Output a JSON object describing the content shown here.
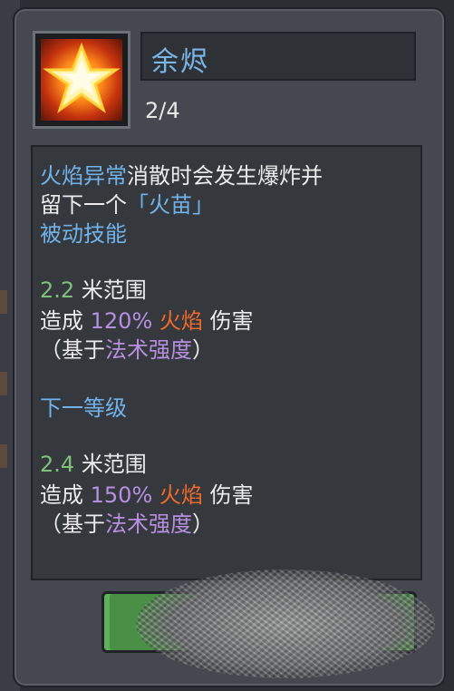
{
  "skill": {
    "name": "余烬",
    "level": "2/4",
    "icon": "fire-star-icon"
  },
  "description": {
    "line1_part1": "火焰异常",
    "line1_part2": "消散时会发生爆炸并",
    "line2_part1": "留下一个",
    "line2_part2": "「火苗」",
    "passive": "被动技能"
  },
  "current": {
    "range_value": "2.2",
    "range_label": "米范围",
    "dmg_prefix": "造成",
    "dmg_percent": "120%",
    "dmg_type": "火焰",
    "dmg_suffix": "伤害",
    "basis_open": "（基于",
    "basis_stat": "法术强度",
    "basis_close": "）"
  },
  "next_level_label": "下一等级",
  "next": {
    "range_value": "2.4",
    "range_label": "米范围",
    "dmg_prefix": "造成",
    "dmg_percent": "150%",
    "dmg_type": "火焰",
    "dmg_suffix": "伤害",
    "basis_open": "（基于",
    "basis_stat": "法术强度",
    "basis_close": "）"
  },
  "colors": {
    "keyword": "#72b2ea",
    "range": "#7fc07a",
    "percent": "#b78fe0",
    "fire": "#f06b2a",
    "button": "#4a8f46"
  }
}
